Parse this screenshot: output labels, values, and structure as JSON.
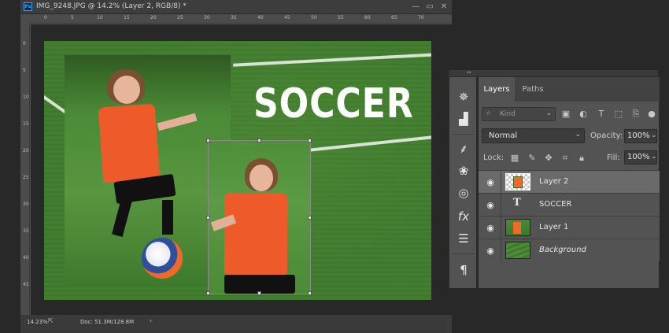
{
  "document": {
    "title": "IMG_9248.JPG @ 14.2% (Layer 2, RGB/8) *",
    "app_icon": "Ps",
    "window_buttons": [
      "—",
      "▭",
      "✕"
    ],
    "ruler_top": [
      "0",
      "5",
      "10",
      "15",
      "20",
      "25",
      "30",
      "35",
      "40",
      "45",
      "50",
      "55",
      "60",
      "65",
      "70"
    ],
    "ruler_left": [
      "0",
      "5",
      "10",
      "15",
      "20",
      "25",
      "30",
      "35",
      "40",
      "45"
    ],
    "canvas_text": "SOCCER",
    "status": {
      "zoom": "14.23%",
      "doc_size": "Doc: 51.3M/128.8M",
      "arrow": "›"
    }
  },
  "icon_strip": {
    "collapse": "››",
    "icons": [
      "navigator-icon",
      "histogram-icon",
      "tools-icon",
      "color-icon",
      "libraries-icon",
      "styles-fx-icon",
      "adjustments-icon",
      "paragraph-icon"
    ]
  },
  "layers_panel": {
    "tabs": [
      {
        "label": "Layers",
        "active": true
      },
      {
        "label": "Paths",
        "active": false
      }
    ],
    "kind_filter": "Kind",
    "blend_mode": "Normal",
    "opacity_label": "Opacity:",
    "opacity_value": "100%",
    "lock_label": "Lock:",
    "fill_label": "Fill:",
    "fill_value": "100%",
    "layers": [
      {
        "name": "Layer 2",
        "type": "pixel",
        "selected": true,
        "visible": true
      },
      {
        "name": "SOCCER",
        "type": "text",
        "selected": false,
        "visible": true
      },
      {
        "name": "Layer 1",
        "type": "pixel",
        "selected": false,
        "visible": true
      },
      {
        "name": "Background",
        "type": "background",
        "selected": false,
        "visible": true
      }
    ]
  },
  "colors": {
    "workspace_bg": "#282828",
    "panel_bg": "#535353",
    "selected_row": "#6a6a6a",
    "ps_blue": "#2fa3ff",
    "jersey_orange": "#ee5a2a",
    "grass_green": "#417a2f"
  }
}
